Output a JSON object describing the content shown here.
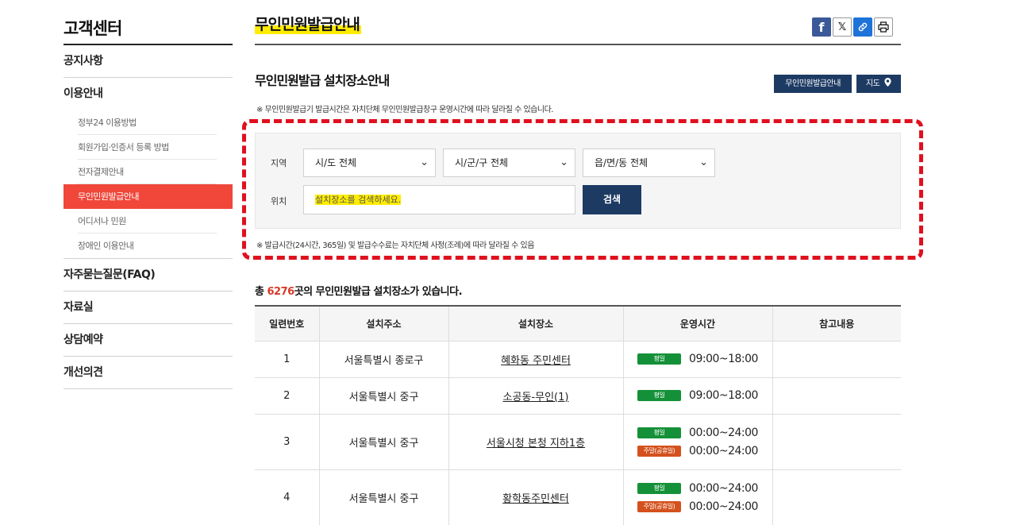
{
  "sidebar": {
    "title": "고객센터",
    "menu": [
      {
        "label": "공지사항"
      },
      {
        "label": "이용안내"
      }
    ],
    "sub_items": [
      {
        "label": "정부24 이용방법"
      },
      {
        "label": "회원가입·인증서 등록 방법"
      },
      {
        "label": "전자결제안내"
      },
      {
        "label": "무인민원발급안내"
      },
      {
        "label": "어디서나 민원"
      },
      {
        "label": "장애인 이용안내"
      }
    ],
    "menu_after": [
      {
        "label": "자주묻는질문(FAQ)"
      },
      {
        "label": "자료실"
      },
      {
        "label": "상담예약"
      },
      {
        "label": "개선의견"
      }
    ]
  },
  "header": {
    "title": "무인민원발급안내",
    "share": {
      "facebook": "f",
      "x": "𝕏",
      "link": "🔗",
      "print": "⎙"
    }
  },
  "section": {
    "title": "무인민원발급 설치장소안내",
    "btn_info": "무인민원발급안내",
    "btn_map": "지도",
    "notice": "※ 무인민원발급기 발급시간은 자치단체 무인민원발급창구 운영시간에 따라 달라질 수 있습니다."
  },
  "search": {
    "region_label": "지역",
    "sido": "시/도 전체",
    "sigungu": "시/군/구 전체",
    "eupmyeondong": "읍/면/동 전체",
    "location_label": "위치",
    "location_placeholder": "설치장소를 검색하세요.",
    "search_button": "검색",
    "notice": "※ 발급시간(24시간, 365일) 및 발급수수료는 자치단체 사정(조례)에 따라 달라질 수 있음"
  },
  "total": {
    "prefix": "총 ",
    "count": "6276",
    "suffix": "곳의 무인민원발급 설치장소가 있습니다."
  },
  "table": {
    "headers": [
      "일련번호",
      "설치주소",
      "설치장소",
      "운영시간",
      "참고내용"
    ],
    "rows": [
      {
        "no": "1",
        "address": "서울특별시 종로구",
        "place": "혜화동 주민센터",
        "hours": [
          {
            "badge": "평일",
            "time": "09:00~18:00"
          }
        ]
      },
      {
        "no": "2",
        "address": "서울특별시 중구",
        "place": "소공동-무인(1)",
        "hours": [
          {
            "badge": "평일",
            "time": "09:00~18:00"
          }
        ]
      },
      {
        "no": "3",
        "address": "서울특별시 중구",
        "place": "서울시청 본청 지하1층",
        "hours": [
          {
            "badge": "평일",
            "time": "00:00~24:00"
          },
          {
            "badge": "주말(공휴일)",
            "time": "00:00~24:00"
          }
        ]
      },
      {
        "no": "4",
        "address": "서울특별시 중구",
        "place": "황학동주민센터",
        "hours": [
          {
            "badge": "평일",
            "time": "00:00~24:00"
          },
          {
            "badge": "주말(공휴일)",
            "time": "00:00~24:00"
          }
        ]
      }
    ]
  },
  "colors": {
    "accent_red": "#f0473a",
    "navy": "#1d3a63",
    "highlight": "#ffec00",
    "weekday_badge": "#149138",
    "weekend_badge": "#d4511d"
  }
}
